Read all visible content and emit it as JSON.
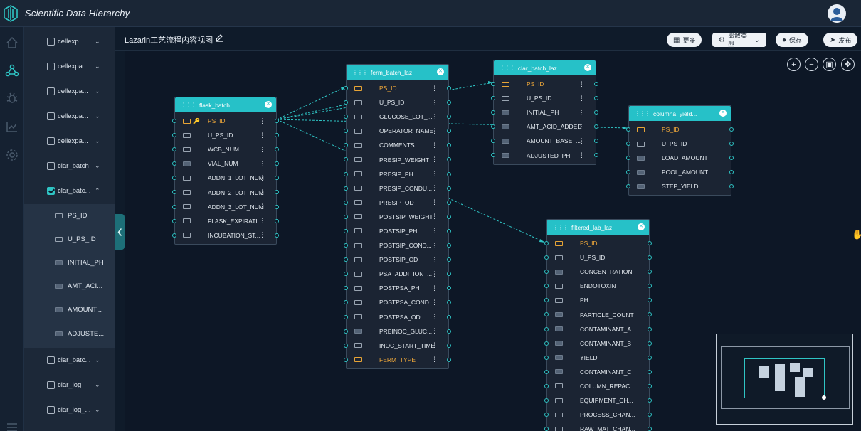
{
  "app": {
    "title": "Scientific Data Hierarchy"
  },
  "toolbar": {
    "view_title": "Lazarin工艺流程内容视图",
    "more_label": "更多",
    "discrete_type_label": "离散类型",
    "save_label": "保存",
    "publish_label": "发布"
  },
  "sidebar": {
    "items": [
      {
        "label": "cellexp",
        "checked": false,
        "expanded": false
      },
      {
        "label": "cellexpa...",
        "checked": false,
        "expanded": false
      },
      {
        "label": "cellexpa...",
        "checked": false,
        "expanded": false
      },
      {
        "label": "cellexpa...",
        "checked": false,
        "expanded": false
      },
      {
        "label": "cellexpa...",
        "checked": false,
        "expanded": false
      },
      {
        "label": "clar_batch",
        "checked": false,
        "expanded": false
      },
      {
        "label": "clar_batc...",
        "checked": true,
        "expanded": true
      },
      {
        "label": "clar_batc...",
        "checked": false,
        "expanded": false
      },
      {
        "label": "clar_log",
        "checked": false,
        "expanded": false
      },
      {
        "label": "clar_log_...",
        "checked": false,
        "expanded": false
      }
    ],
    "children": [
      {
        "label": "PS_ID",
        "type": "text"
      },
      {
        "label": "U_PS_ID",
        "type": "text"
      },
      {
        "label": "INITIAL_PH",
        "type": "number"
      },
      {
        "label": "AMT_ACI...",
        "type": "number"
      },
      {
        "label": "AMOUNT...",
        "type": "number"
      },
      {
        "label": "ADJUSTE...",
        "type": "number"
      }
    ]
  },
  "tables": {
    "flask_batch": {
      "name": "flask_batch",
      "fields": [
        {
          "name": "PS_ID",
          "pk": true,
          "type": "text"
        },
        {
          "name": "U_PS_ID",
          "type": "text"
        },
        {
          "name": "WCB_NUM",
          "type": "text"
        },
        {
          "name": "VIAL_NUM",
          "type": "number"
        },
        {
          "name": "ADDN_1_LOT_NUM",
          "type": "text"
        },
        {
          "name": "ADDN_2_LOT_NUM",
          "type": "text"
        },
        {
          "name": "ADDN_3_LOT_NUM",
          "type": "text"
        },
        {
          "name": "FLASK_EXPIRATI...",
          "type": "text"
        },
        {
          "name": "INCUBATION_ST...",
          "type": "text"
        }
      ]
    },
    "ferm_batch_laz": {
      "name": "ferm_batch_laz",
      "fields": [
        {
          "name": "PS_ID",
          "pk": true,
          "type": "text"
        },
        {
          "name": "U_PS_ID",
          "type": "text"
        },
        {
          "name": "GLUCOSE_LOT_...",
          "type": "text"
        },
        {
          "name": "OPERATOR_NAME",
          "type": "text"
        },
        {
          "name": "COMMENTS",
          "type": "text"
        },
        {
          "name": "PRESIP_WEIGHT",
          "type": "text"
        },
        {
          "name": "PRESIP_PH",
          "type": "text"
        },
        {
          "name": "PRESIP_CONDU...",
          "type": "text"
        },
        {
          "name": "PRESIP_OD",
          "type": "text"
        },
        {
          "name": "POSTSIP_WEIGHT",
          "type": "text"
        },
        {
          "name": "POSTSIP_PH",
          "type": "text"
        },
        {
          "name": "POSTSIP_COND...",
          "type": "text"
        },
        {
          "name": "POSTSIP_OD",
          "type": "text"
        },
        {
          "name": "PSA_ADDITION_...",
          "type": "text"
        },
        {
          "name": "POSTPSA_PH",
          "type": "text"
        },
        {
          "name": "POSTPSA_COND...",
          "type": "text"
        },
        {
          "name": "POSTPSA_OD",
          "type": "text"
        },
        {
          "name": "PREINOC_GLUC...",
          "type": "number"
        },
        {
          "name": "INOC_START_TIME",
          "type": "text"
        },
        {
          "name": "FERM_TYPE",
          "pk": true,
          "type": "text"
        }
      ]
    },
    "clar_batch_laz": {
      "name": "clar_batch_laz",
      "fields": [
        {
          "name": "PS_ID",
          "pk": true,
          "type": "text"
        },
        {
          "name": "U_PS_ID",
          "type": "text"
        },
        {
          "name": "INITIAL_PH",
          "type": "number"
        },
        {
          "name": "AMT_ACID_ADDED",
          "type": "number"
        },
        {
          "name": "AMOUNT_BASE_...",
          "type": "number"
        },
        {
          "name": "ADJUSTED_PH",
          "type": "number"
        }
      ]
    },
    "columna_yield": {
      "name": "columna_yield...",
      "fields": [
        {
          "name": "PS_ID",
          "pk": true,
          "type": "text"
        },
        {
          "name": "U_PS_ID",
          "type": "text"
        },
        {
          "name": "LOAD_AMOUNT",
          "type": "number"
        },
        {
          "name": "POOL_AMOUNT",
          "type": "number"
        },
        {
          "name": "STEP_YIELD",
          "type": "number"
        }
      ]
    },
    "filtered_lab_laz": {
      "name": "filtered_lab_laz",
      "fields": [
        {
          "name": "PS_ID",
          "pk": true,
          "type": "text"
        },
        {
          "name": "U_PS_ID",
          "type": "text"
        },
        {
          "name": "CONCENTRATION",
          "type": "number"
        },
        {
          "name": "ENDOTOXIN",
          "type": "text"
        },
        {
          "name": "PH",
          "type": "text"
        },
        {
          "name": "PARTICLE_COUNT",
          "type": "number"
        },
        {
          "name": "CONTAMINANT_A",
          "type": "number"
        },
        {
          "name": "CONTAMINANT_B",
          "type": "number"
        },
        {
          "name": "YIELD",
          "type": "number"
        },
        {
          "name": "CONTAMINANT_C",
          "type": "number"
        },
        {
          "name": "COLUMN_REPAC...",
          "type": "text"
        },
        {
          "name": "EQUIPMENT_CH...",
          "type": "text"
        },
        {
          "name": "PROCESS_CHAN...",
          "type": "text"
        },
        {
          "name": "RAW_MAT_CHAN...",
          "type": "text"
        }
      ]
    }
  },
  "colors": {
    "accent": "#26c1c8",
    "primary_key": "#f1a93a",
    "canvas": "#0d1726"
  },
  "icons": {
    "rail": [
      "home-icon",
      "hierarchy-icon",
      "bug-icon",
      "chart-icon",
      "settings-icon"
    ],
    "zoom": [
      "zoom-in-icon",
      "zoom-out-icon",
      "fit-screen-icon",
      "center-icon"
    ]
  }
}
